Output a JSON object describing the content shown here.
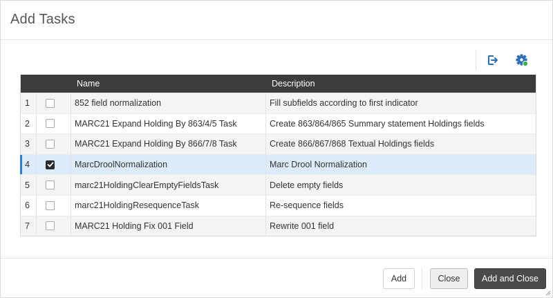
{
  "dialog": {
    "title": "Add Tasks"
  },
  "toolbar": {
    "export_icon": "export-icon",
    "settings_icon": "gear-icon"
  },
  "table": {
    "columns": [
      "",
      "",
      "Name",
      "Description"
    ],
    "rows": [
      {
        "num": "1",
        "checked": false,
        "name": "852 field normalization",
        "description": "Fill subfields according to first indicator"
      },
      {
        "num": "2",
        "checked": false,
        "name": "MARC21 Expand Holding By 863/4/5 Task",
        "description": "Create 863/864/865 Summary statement Holdings fields"
      },
      {
        "num": "3",
        "checked": false,
        "name": "MARC21 Expand Holding By 866/7/8 Task",
        "description": "Create 866/867/868 Textual Holdings fields"
      },
      {
        "num": "4",
        "checked": true,
        "name": "MarcDroolNormalization",
        "description": "Marc Drool Normalization"
      },
      {
        "num": "5",
        "checked": false,
        "name": "marc21HoldingClearEmptyFieldsTask",
        "description": "Delete empty fields"
      },
      {
        "num": "6",
        "checked": false,
        "name": "marc21HoldingResequenceTask",
        "description": "Re-sequence fields"
      },
      {
        "num": "7",
        "checked": false,
        "name": "MARC21 Holding Fix 001 Field",
        "description": "Rewrite 001 field"
      }
    ]
  },
  "footer": {
    "add_label": "Add",
    "close_label": "Close",
    "add_close_label": "Add and Close"
  },
  "colors": {
    "header_bg": "#3c3c3c",
    "selected_bg": "#dcebf9",
    "selected_accent": "#2e7dd1",
    "primary_btn": "#4a4a4a",
    "icon_blue": "#2a6db5",
    "icon_green": "#3ab24a"
  }
}
